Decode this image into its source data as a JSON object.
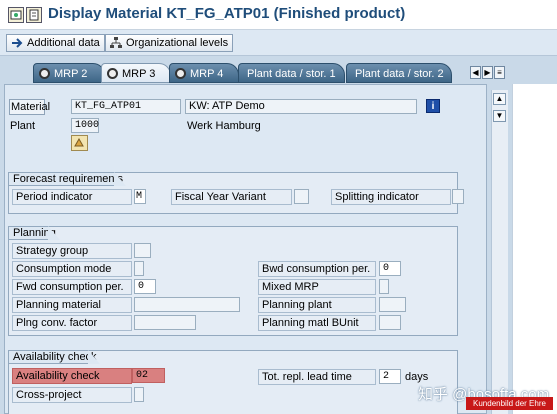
{
  "window": {
    "title": "Display Material KT_FG_ATP01 (Finished product)",
    "title_icons": [
      "display-icon",
      "document-icon"
    ]
  },
  "toolbar": {
    "additional_data": "Additional data",
    "org_levels": "Organizational levels"
  },
  "tabs": [
    {
      "label": "MRP 2",
      "icon": "traffic-light-icon",
      "active": false
    },
    {
      "label": "MRP 3",
      "icon": "traffic-light-icon",
      "active": true
    },
    {
      "label": "MRP 4",
      "icon": "traffic-light-icon",
      "active": false
    },
    {
      "label": "Plant data / stor. 1",
      "active": false
    },
    {
      "label": "Plant data / stor. 2",
      "active": false
    }
  ],
  "header": {
    "material_label": "Material",
    "material_value": "KT_FG_ATP01",
    "material_desc": "KW: ATP Demo",
    "plant_label": "Plant",
    "plant_value": "1000",
    "plant_desc": "Werk Hamburg"
  },
  "forecast": {
    "title": "Forecast requirements",
    "period_indicator_label": "Period indicator",
    "period_indicator_value": "M",
    "fiscal_year_variant_label": "Fiscal Year Variant",
    "fiscal_year_variant_value": "",
    "splitting_indicator_label": "Splitting indicator",
    "splitting_indicator_value": ""
  },
  "planning": {
    "title": "Planning",
    "strategy_group_label": "Strategy group",
    "consumption_mode_label": "Consumption mode",
    "bwd_consumption_label": "Bwd consumption per.",
    "bwd_consumption_value": "0",
    "fwd_consumption_label": "Fwd consumption per.",
    "fwd_consumption_value": "0",
    "mixed_mrp_label": "Mixed MRP",
    "planning_material_label": "Planning material",
    "planning_plant_label": "Planning plant",
    "plng_conv_factor_label": "Plng conv. factor",
    "planning_matl_bunit_label": "Planning matl BUnit"
  },
  "availability": {
    "title": "Availability check",
    "availability_check_label": "Availability check",
    "availability_check_value": "02",
    "tot_repl_lead_time_label": "Tot. repl. lead time",
    "tot_repl_lead_time_value": "2",
    "tot_repl_lead_time_unit": "days",
    "cross_project_label": "Cross-project"
  },
  "overlay": {
    "watermark": "知乎 @bosofta.com",
    "badge": "Kundenbild der Ehre"
  },
  "colors": {
    "title_blue": "#1f4d7a",
    "tab_dark": "#3e6687",
    "highlight_red": "#d98080",
    "info_blue": "#1f4fa8"
  }
}
